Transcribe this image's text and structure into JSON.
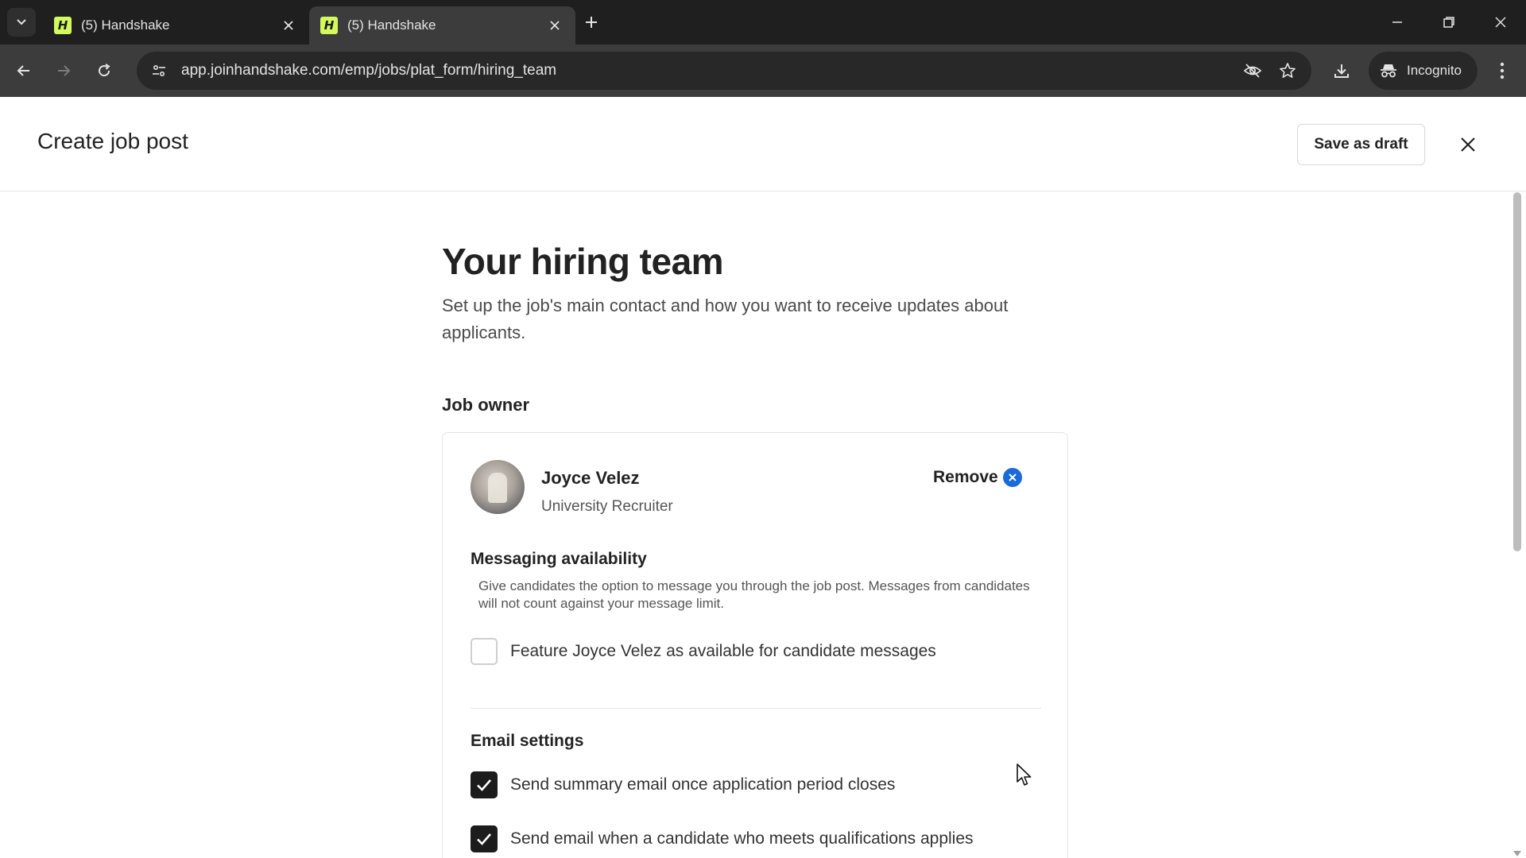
{
  "browser": {
    "tabs": [
      {
        "title": "(5) Handshake",
        "active": false
      },
      {
        "title": "(5) Handshake",
        "active": true
      }
    ],
    "url": "app.joinhandshake.com/emp/jobs/plat_form/hiring_team",
    "incognito_label": "Incognito",
    "favicon_letter": "H",
    "favicon_color": "#d4f95c"
  },
  "header": {
    "title": "Create job post",
    "save_draft_label": "Save as draft"
  },
  "main": {
    "title": "Your hiring team",
    "subtitle": "Set up the job's main contact and how you want to receive updates about applicants.",
    "job_owner_label": "Job owner",
    "owner": {
      "name": "Joyce Velez",
      "role": "University Recruiter",
      "remove_label": "Remove"
    },
    "messaging": {
      "heading": "Messaging availability",
      "description": "Give candidates the option to message you through the job post. Messages from candidates will not count against your message limit.",
      "checkbox_label": "Feature Joyce Velez as available for candidate messages",
      "checked": false
    },
    "email": {
      "heading": "Email settings",
      "options": [
        {
          "label": "Send summary email once application period closes",
          "checked": true
        },
        {
          "label": "Send email when a candidate who meets qualifications applies",
          "checked": true
        }
      ]
    }
  },
  "colors": {
    "accent_blue": "#1c6ad8",
    "checkbox_checked": "#1c1c1c"
  }
}
